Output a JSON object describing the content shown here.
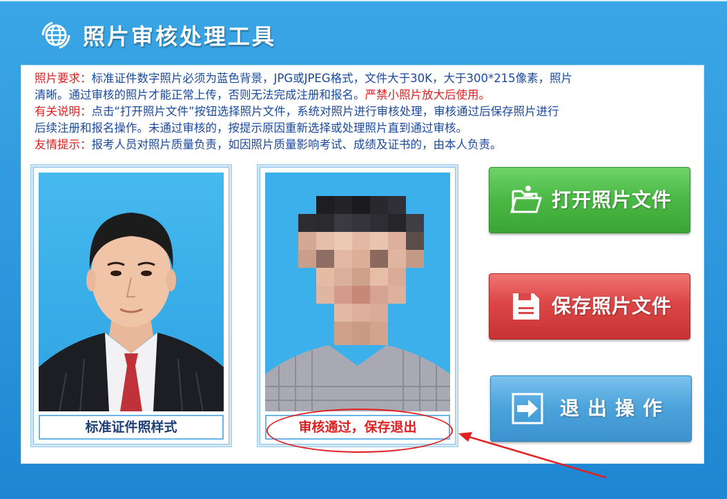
{
  "app": {
    "title": "照片审核处理工具"
  },
  "notice": {
    "requirements_label": "照片要求：",
    "requirements_text_1": "标准证件数字照片必须为蓝色背景，JPG或JPEG格式，文件大于30K，大于300*215像素，照片",
    "requirements_text_2": "清晰。通过审核的照片才能正常上传，否则无法完成注册和报名。",
    "requirements_warning": "严禁小照片放大后使用。",
    "explanation_label": "有关说明：",
    "explanation_text_1": "点击“打开照片文件”按钮选择照片文件，系统对照片进行审核处理，审核通过后保存照片进行",
    "explanation_text_2": "后续注册和报名操作。未通过审核的，按提示原因重新选择或处理照片直到通过审核。",
    "tip_label": "友情提示：",
    "tip_text": "报考人员对照片质量负责，如因照片质量影响考试、成绩及证书的，由本人负责。"
  },
  "photos": {
    "sample_caption": "标准证件照样式",
    "result_status": "审核通过，保存退出"
  },
  "buttons": {
    "open_label": "打开照片文件",
    "save_label": "保存照片文件",
    "exit_label": "退出操作"
  },
  "colors": {
    "accent_red": "#e02020",
    "text_blue": "#1a4aa0",
    "open_green": "#4cba46",
    "save_red": "#dc4646",
    "exit_blue": "#4ea5dc",
    "photo_bg": "#3cb0ea"
  },
  "icons": {
    "logo": "globe-icon",
    "open": "open-folder-icon",
    "save": "save-disk-icon",
    "exit": "exit-arrow-icon"
  }
}
